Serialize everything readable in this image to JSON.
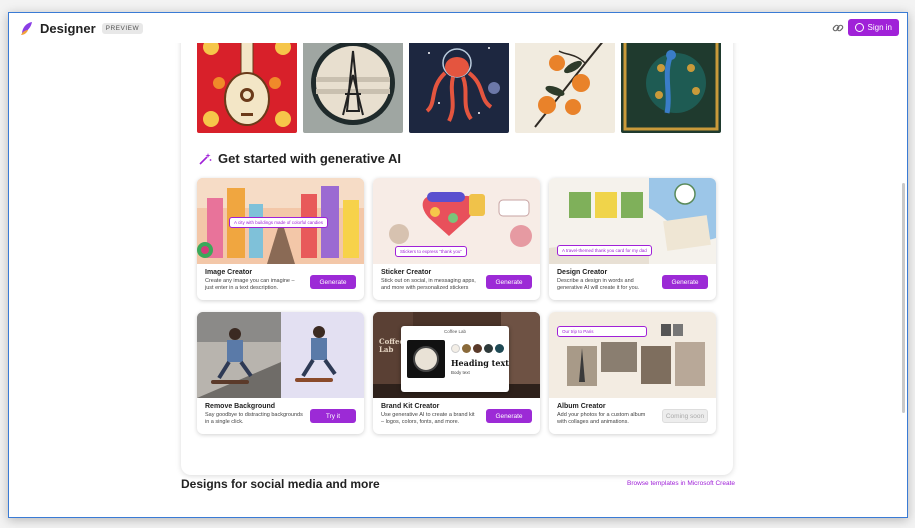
{
  "app": {
    "brand": "Designer",
    "badge": "PREVIEW",
    "sign_in": "Sign in"
  },
  "colors": {
    "accent": "#a021d8",
    "button": "#9c2ad6"
  },
  "icons": {
    "logo": "designer-logo-icon",
    "share": "share-link-icon",
    "account": "account-icon",
    "wand": "magic-wand-icon"
  },
  "generative": {
    "heading": "Get started with generative AI",
    "cards": [
      {
        "title": "Image Creator",
        "description": "Create any image you can imagine – just enter in a text description.",
        "button": "Generate",
        "prompt": "A city with buildings made of colorful candies"
      },
      {
        "title": "Sticker Creator",
        "description": "Stick out on social, in messaging apps, and more with personalized stickers",
        "button": "Generate",
        "prompt": "Stickers to express \"thank you\""
      },
      {
        "title": "Design Creator",
        "description": "Describe a design in words and generative AI will create it for you.",
        "button": "Generate",
        "prompt": "A travel-themed thank you card for my dad"
      },
      {
        "title": "Remove Background",
        "description": "Say goodbye to distracting backgrounds in a single click.",
        "button": "Try it"
      },
      {
        "title": "Brand Kit Creator",
        "description": "Use generative AI to create a brand kit – logos, colors, fonts, and more.",
        "button": "Generate",
        "brand_name": "Coffee Lab",
        "heading_sample": "Heading text",
        "body_sample": "Body text",
        "sign_text": "Coffee Lab"
      },
      {
        "title": "Album Creator",
        "description": "Add your photos for a custom album with collages and animations.",
        "button": "Coming soon",
        "prompt": "Our trip to Paris"
      }
    ]
  },
  "sections": {
    "social_title": "Designs for social media and more",
    "browse_link": "Browse templates in Microsoft Create"
  }
}
